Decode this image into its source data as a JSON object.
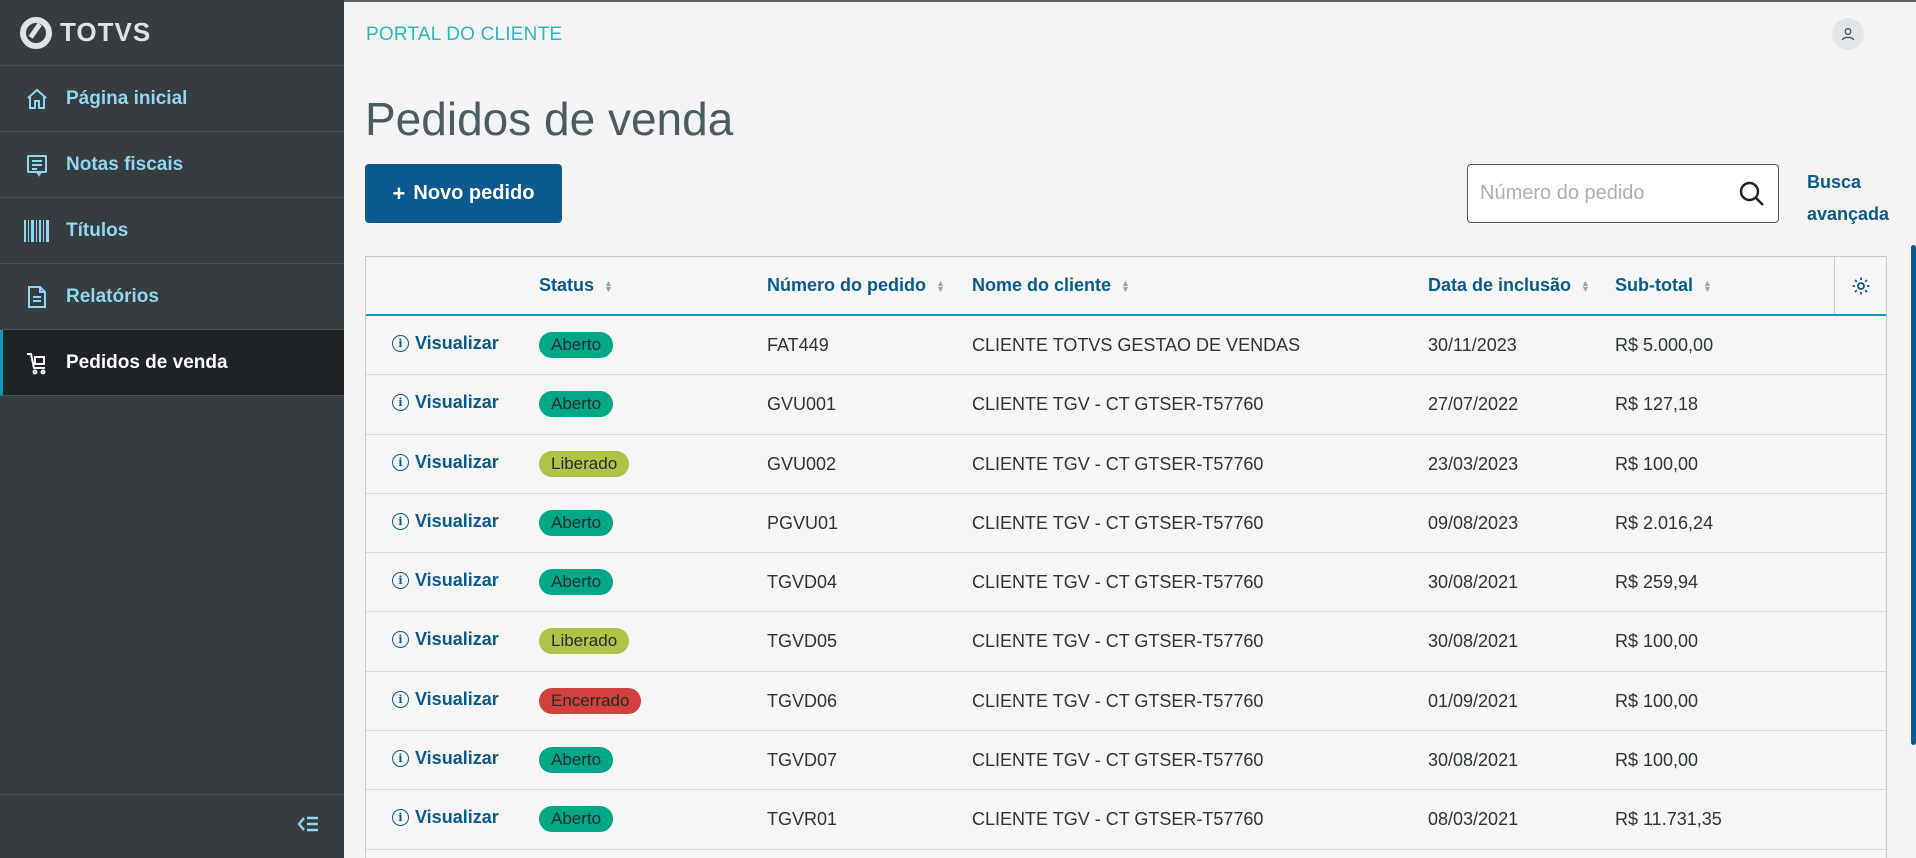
{
  "brand": {
    "name": "TOTVS"
  },
  "sidebar": {
    "items": [
      {
        "label": "Página inicial",
        "icon": "home-icon"
      },
      {
        "label": "Notas fiscais",
        "icon": "receipt-icon"
      },
      {
        "label": "Títulos",
        "icon": "barcode-icon"
      },
      {
        "label": "Relatórios",
        "icon": "document-icon"
      },
      {
        "label": "Pedidos de venda",
        "icon": "cart-icon",
        "active": true
      }
    ],
    "collapse_icon": "collapse-menu-icon"
  },
  "header": {
    "portal_title": "PORTAL DO CLIENTE",
    "avatar_icon": "user-icon"
  },
  "page": {
    "title": "Pedidos de venda",
    "new_button": "Novo pedido",
    "search_placeholder": "Número do pedido",
    "advanced_search": "Busca avançada"
  },
  "table": {
    "columns": [
      "Status",
      "Número do pedido",
      "Nome do cliente",
      "Data de inclusão",
      "Sub-total"
    ],
    "view_label": "Visualizar",
    "rows": [
      {
        "status": "Aberto",
        "number": "FAT449",
        "client": "CLIENTE TOTVS GESTAO DE VENDAS",
        "date": "30/11/2023",
        "subtotal": "R$ 5.000,00"
      },
      {
        "status": "Aberto",
        "number": "GVU001",
        "client": "CLIENTE TGV - CT GTSER-T57760",
        "date": "27/07/2022",
        "subtotal": "R$ 127,18"
      },
      {
        "status": "Liberado",
        "number": "GVU002",
        "client": "CLIENTE TGV - CT GTSER-T57760",
        "date": "23/03/2023",
        "subtotal": "R$ 100,00"
      },
      {
        "status": "Aberto",
        "number": "PGVU01",
        "client": "CLIENTE TGV - CT GTSER-T57760",
        "date": "09/08/2023",
        "subtotal": "R$ 2.016,24"
      },
      {
        "status": "Aberto",
        "number": "TGVD04",
        "client": "CLIENTE TGV - CT GTSER-T57760",
        "date": "30/08/2021",
        "subtotal": "R$ 259,94"
      },
      {
        "status": "Liberado",
        "number": "TGVD05",
        "client": "CLIENTE TGV - CT GTSER-T57760",
        "date": "30/08/2021",
        "subtotal": "R$ 100,00"
      },
      {
        "status": "Encerrado",
        "number": "TGVD06",
        "client": "CLIENTE TGV - CT GTSER-T57760",
        "date": "01/09/2021",
        "subtotal": "R$ 100,00"
      },
      {
        "status": "Aberto",
        "number": "TGVD07",
        "client": "CLIENTE TGV - CT GTSER-T57760",
        "date": "30/08/2021",
        "subtotal": "R$ 100,00"
      },
      {
        "status": "Aberto",
        "number": "TGVR01",
        "client": "CLIENTE TGV - CT GTSER-T57760",
        "date": "08/03/2021",
        "subtotal": "R$ 11.731,35"
      }
    ]
  },
  "colors": {
    "accent": "#0b5a8f",
    "sidebar": "#363c3f",
    "aberto": "#00a886",
    "liberado": "#aec447",
    "encerrado": "#d1403b"
  }
}
